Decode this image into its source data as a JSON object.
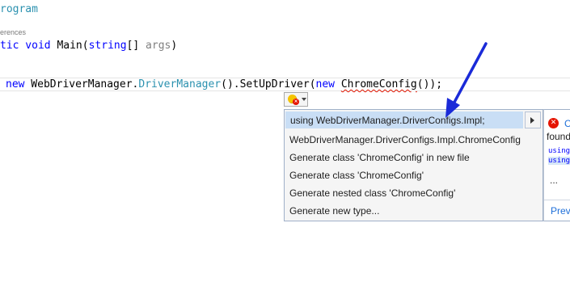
{
  "editor": {
    "line1": {
      "text": "rogram"
    },
    "references": "erences",
    "line2": {
      "kw": "tic void",
      "name": " Main(",
      "kw2": "string",
      "rest": "[] ",
      "param": "args",
      "end": ")"
    },
    "line3": {
      "kw_new": "new",
      "t1": " WebDriverManager.",
      "type1": "DriverManager",
      "t2": "().SetUpDriver(",
      "kw_new2": "new",
      "sp": " ",
      "error_type": "ChromeConfig",
      "t3": "());"
    }
  },
  "quick_actions": {
    "items": [
      {
        "label": "using WebDriverManager.DriverConfigs.Impl;",
        "selected": true
      },
      {
        "label": "WebDriverManager.DriverConfigs.Impl.ChromeConfig"
      },
      {
        "label": "Generate class 'ChromeConfig' in new file"
      },
      {
        "label": "Generate class 'ChromeConfig'"
      },
      {
        "label": "Generate nested class 'ChromeConfig'"
      },
      {
        "label": "Generate new type..."
      }
    ]
  },
  "preview": {
    "error_code": "C",
    "found_text": "found",
    "using1": "using",
    "using2": "using",
    "ellipsis": "...",
    "link": "Previ"
  },
  "colors": {
    "keyword": "#0000ff",
    "type": "#2b91af",
    "selection": "#c9def5",
    "annotation_arrow": "#1a2ad8"
  }
}
